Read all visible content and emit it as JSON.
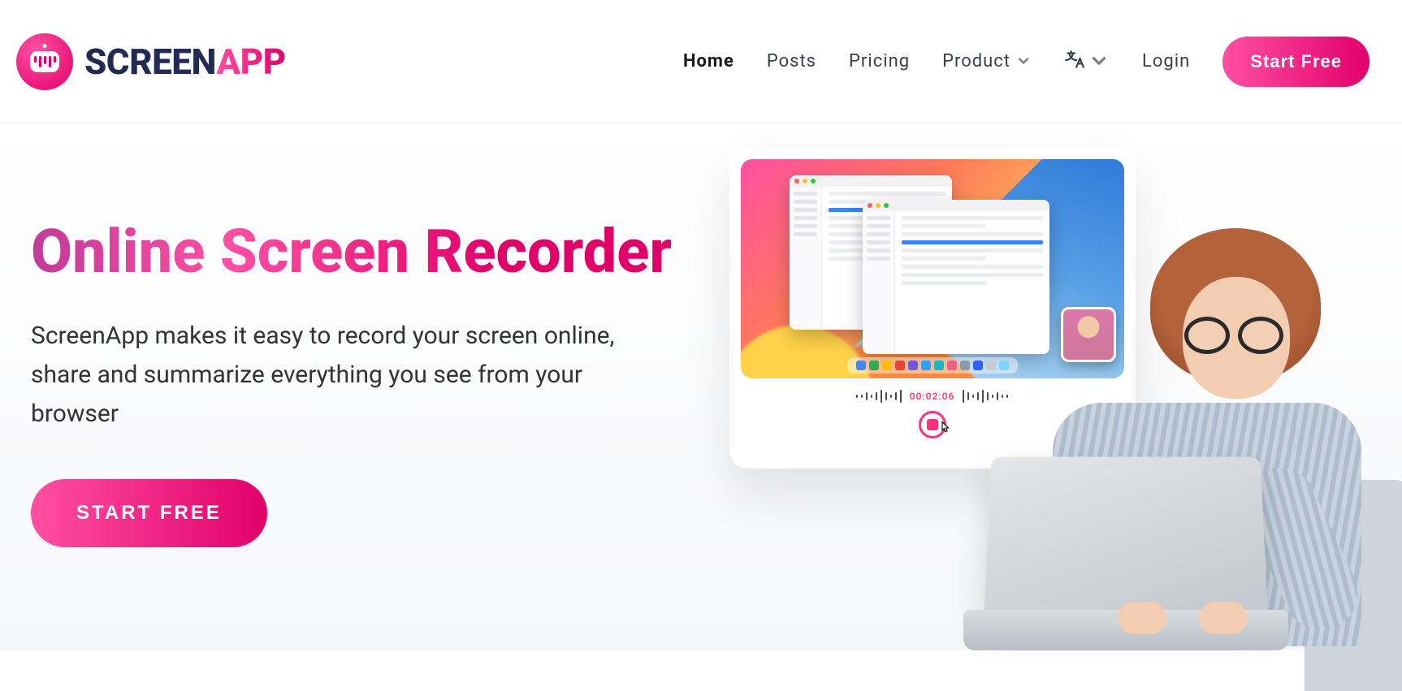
{
  "brand": {
    "part1": "SCREEN",
    "part2": "APP"
  },
  "nav": {
    "home": "Home",
    "posts": "Posts",
    "pricing": "Pricing",
    "product": "Product",
    "login": "Login",
    "start_free": "Start Free"
  },
  "hero": {
    "title": "Online Screen Recorder",
    "subtitle": "ScreenApp makes it easy to record your screen online, share and summarize everything you see from your browser",
    "cta": "START FREE"
  },
  "recorder": {
    "time": "00:02:06"
  }
}
